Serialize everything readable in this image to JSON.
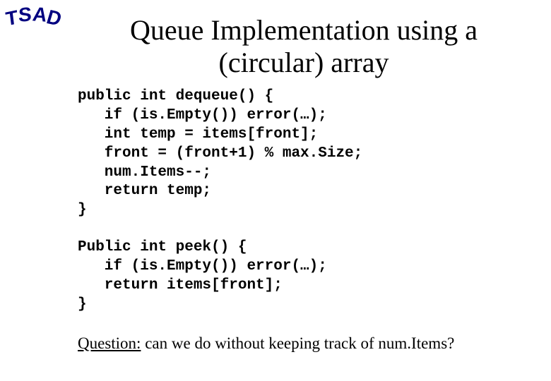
{
  "logo": {
    "c1": "T",
    "c2": "S",
    "c3": "A",
    "c4": "D"
  },
  "slide": {
    "title_line1": "Queue Implementation using a",
    "title_line2": "(circular) array",
    "code1": "public int dequeue() {\n   if (is.Empty()) error(…);\n   int temp = items[front];\n   front = (front+1) % max.Size;\n   num.Items--;\n   return temp;\n}",
    "code2": "Public int peek() {\n   if (is.Empty()) error(…);\n   return items[front];\n}",
    "question_label": "Question:",
    "question_text": " can we do without keeping track of num.Items?"
  }
}
